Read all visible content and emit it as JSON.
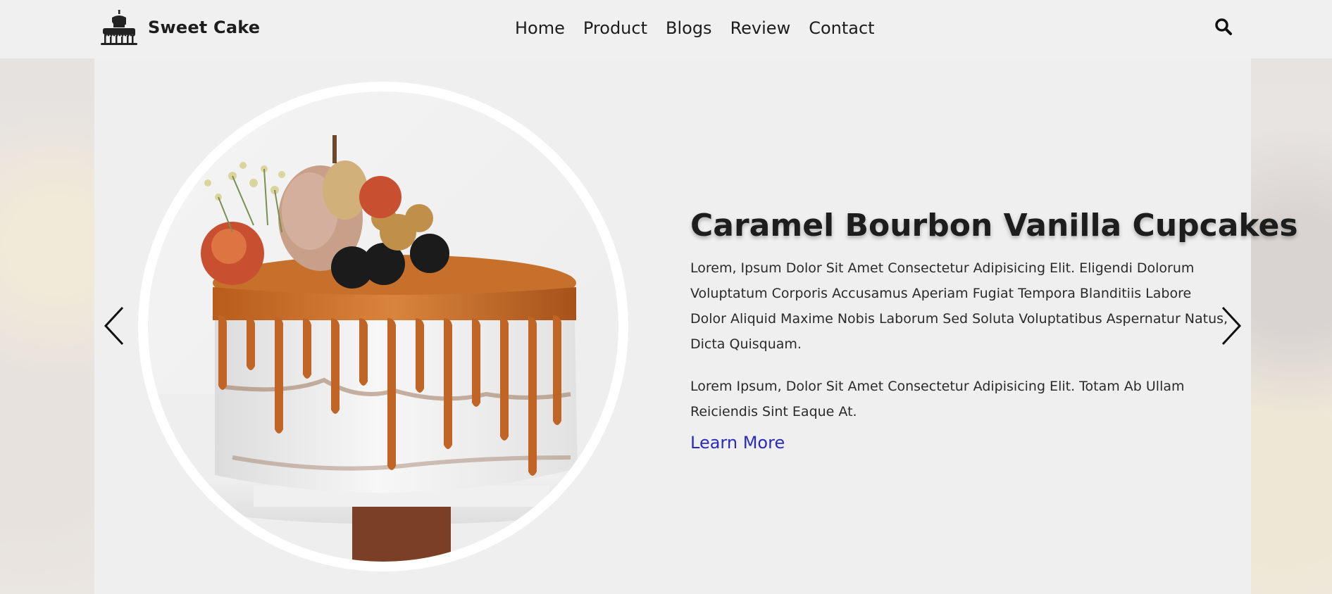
{
  "header": {
    "brand": {
      "name": "Sweet Cake",
      "logo_icon": "cake-logo-icon"
    },
    "nav": [
      {
        "label": "Home"
      },
      {
        "label": "Product"
      },
      {
        "label": "Blogs"
      },
      {
        "label": "Review"
      },
      {
        "label": "Contact"
      }
    ],
    "search_icon": "search-icon"
  },
  "slider": {
    "prev_icon": "chevron-left-icon",
    "next_icon": "chevron-right-icon",
    "slide": {
      "title": "Caramel Bourbon Vanilla Cupcakes",
      "paragraphs": [
        "Lorem, Ipsum Dolor Sit Amet Consectetur Adipisicing Elit. Eligendi Dolorum Voluptatum Corporis Accusamus Aperiam Fugiat Tempora Blanditiis Labore Dolor Aliquid Maxime Nobis Laborum Sed Soluta Voluptatibus Aspernatur Natus, Dicta Quisquam.",
        "Lorem Ipsum, Dolor Sit Amet Consectetur Adipisicing Elit. Totam Ab Ullam Reiciendis Sint Eaque At."
      ],
      "cta_label": "Learn More",
      "image_subject": "caramel drip cake with fruit and flowers"
    }
  },
  "colors": {
    "text_primary": "#1d1d1d",
    "link": "#2b2bbf",
    "background": "#efefef"
  }
}
